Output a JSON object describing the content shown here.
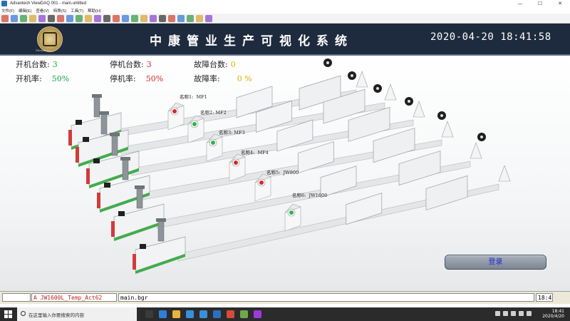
{
  "window": {
    "title": "Advantech ViewDAQ 001 - main.untitled",
    "controls": {
      "minimize": "—",
      "maximize": "☐",
      "close": "✕"
    }
  },
  "menu": [
    "文件(F)",
    "编辑(E)",
    "查看(V)",
    "特殊(S)",
    "工具(T)",
    "帮助(H)"
  ],
  "toolbar": {
    "icons": [
      "new-icon",
      "open-icon",
      "save-icon",
      "cut-icon",
      "copy-icon",
      "paste-icon",
      "tag-icon",
      "run-icon",
      "stop-icon",
      "tool-icon",
      "wire-icon",
      "lock-icon",
      "check-icon",
      "ruler-icon",
      "cross-icon",
      "back-icon",
      "forward-icon",
      "refresh-icon",
      "print-icon",
      "find-icon",
      "delete-icon",
      "info-icon",
      "pin-icon"
    ],
    "colors": [
      "#d24b3a",
      "#3a7bd5",
      "#3a9c4a",
      "#d5a83a",
      "#8a4bd2",
      "#3a3a3a"
    ]
  },
  "header": {
    "logo_caption": "ZhenKang",
    "title": "中康管业生产可视化系统",
    "datetime": "2020-04-20 18:41:58",
    "background": "#1e2a3d"
  },
  "stats": {
    "running_count_label": "开机台数:",
    "running_count": "3",
    "stopped_count_label": "停机台数:",
    "stopped_count": "3",
    "fault_count_label": "故障台数:",
    "fault_count": "0",
    "running_rate_label": "开机率:",
    "running_rate": "50%",
    "stopped_rate_label": "停机率:",
    "stopped_rate": "50%",
    "fault_rate_label": "故障率:",
    "fault_rate": "0 %",
    "colors": {
      "running": "#1aa84a",
      "stopped": "#d42b2b",
      "fault": "#e0b000"
    }
  },
  "machines": [
    {
      "label": "名称1:",
      "name": "MF1",
      "status": "stopped"
    },
    {
      "label": "名称2:",
      "name": "MF2",
      "status": "running"
    },
    {
      "label": "名称3:",
      "name": "MF3",
      "status": "running"
    },
    {
      "label": "名称4:",
      "name": "MF4",
      "status": "stopped"
    },
    {
      "label": "名称5:",
      "name": "JW800",
      "status": "stopped"
    },
    {
      "label": "名称6:",
      "name": "JW1600",
      "status": "running"
    }
  ],
  "status_colors": {
    "running": "#2fb54a",
    "stopped": "#d42b2b"
  },
  "login_button": "登录",
  "statusbar": {
    "alarm_flag": "A",
    "alarm_tag": "JW1600L_Temp_Act62",
    "file": "main.bgr",
    "clock": "18:4"
  },
  "taskbar": {
    "search_placeholder": "在这里输入你要搜索的内容",
    "apps": [
      "task-view-icon",
      "edge-icon",
      "explorer-icon",
      "store-icon",
      "mail-icon",
      "ie-icon",
      "chrome-icon",
      "app-icon",
      "viewdaq-icon"
    ],
    "time": "18:41",
    "date": "2020/4/20"
  }
}
